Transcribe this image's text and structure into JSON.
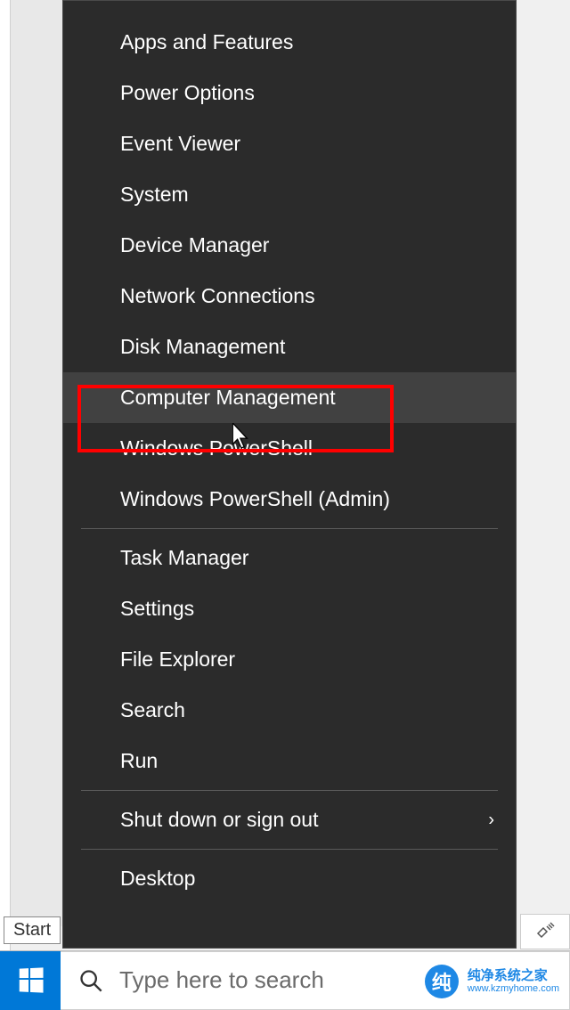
{
  "menu": {
    "group1": [
      "Apps and Features",
      "Power Options",
      "Event Viewer",
      "System",
      "Device Manager",
      "Network Connections",
      "Disk Management",
      "Computer Management",
      "Windows PowerShell",
      "Windows PowerShell (Admin)"
    ],
    "group2": [
      "Task Manager",
      "Settings",
      "File Explorer",
      "Search",
      "Run"
    ],
    "group3": [
      "Shut down or sign out"
    ],
    "group4": [
      "Desktop"
    ],
    "highlighted_index": 7
  },
  "tooltip": {
    "start": "Start"
  },
  "taskbar": {
    "search_placeholder": "Type here to search"
  },
  "watermark": {
    "badge": "纯",
    "name": "纯净系统之家",
    "url": "www.kzmyhome.com"
  }
}
